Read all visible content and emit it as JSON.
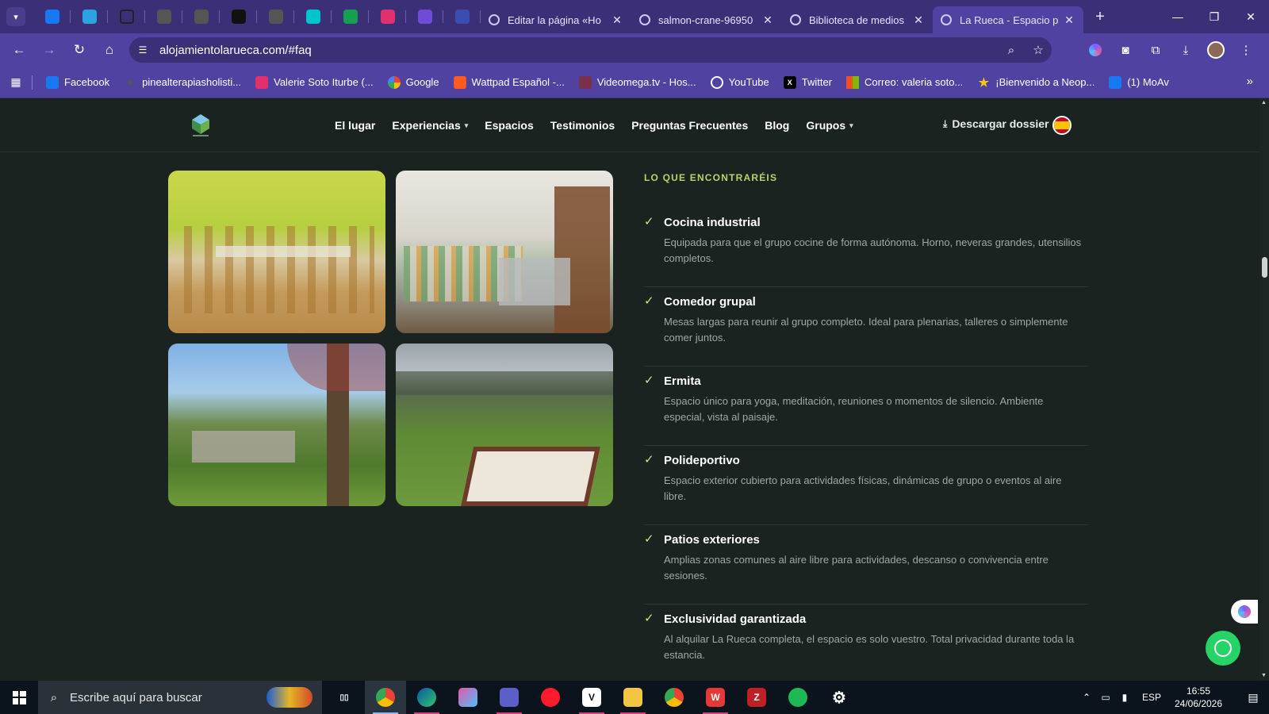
{
  "browser": {
    "tabs": [
      {
        "label": "Editar la página «Ho",
        "active": false
      },
      {
        "label": "salmon-crane-96950",
        "active": false
      },
      {
        "label": "Biblioteca de medios",
        "active": false
      },
      {
        "label": "La Rueca - Espacio p",
        "active": true
      }
    ],
    "pinned_icons": [
      "facebook-icon",
      "telegram-icon",
      "chatgpt-icon",
      "goodreads-icon",
      "goodreads-icon",
      "font-icon",
      "globe-icon",
      "canva-icon",
      "grammar-icon",
      "instagram-icon",
      "craft-icon",
      "dashboard-icon"
    ],
    "url": "alojamientolarueca.com/#faq",
    "bookmarks": [
      {
        "label": "Facebook",
        "icon": "facebook-icon",
        "color": "#1877f2"
      },
      {
        "label": "pinealterapiasholisti...",
        "icon": "dot-icon",
        "color": "#555555"
      },
      {
        "label": "Valerie Soto Iturbe (...",
        "icon": "instagram-icon",
        "color": "#e1306c"
      },
      {
        "label": "Google",
        "icon": "google-icon",
        "color": "#ffffff"
      },
      {
        "label": "Wattpad Español -...",
        "icon": "wattpad-icon",
        "color": "#ff5a1f"
      },
      {
        "label": "Videomega.tv - Hos...",
        "icon": "vm-icon",
        "color": "#7a2f4a"
      },
      {
        "label": "YouTube",
        "icon": "globe-icon",
        "color": "#555555"
      },
      {
        "label": "Twitter",
        "icon": "x-icon",
        "color": "#000000"
      },
      {
        "label": "Correo: valeria soto...",
        "icon": "microsoft-icon",
        "color": "#f25022"
      },
      {
        "label": "¡Bienvenido a Neop...",
        "icon": "star-icon",
        "color": "#f5c518"
      },
      {
        "label": "(1) MoAv",
        "icon": "facebook-icon",
        "color": "#1877f2"
      }
    ]
  },
  "site": {
    "nav": [
      {
        "label": "El lugar",
        "dropdown": false
      },
      {
        "label": "Experiencias",
        "dropdown": true
      },
      {
        "label": "Espacios",
        "dropdown": false
      },
      {
        "label": "Testimonios",
        "dropdown": false
      },
      {
        "label": "Preguntas Frecuentes",
        "dropdown": false
      },
      {
        "label": "Blog",
        "dropdown": false
      },
      {
        "label": "Grupos",
        "dropdown": true
      }
    ],
    "dossier_label": "Descargar dossier",
    "section_label": "LO QUE ENCONTRARÉIS",
    "features": [
      {
        "title": "Cocina industrial",
        "desc": "Equipada para que el grupo cocine de forma autónoma. Horno, neveras grandes, utensilios completos."
      },
      {
        "title": "Comedor grupal",
        "desc": "Mesas largas para reunir al grupo completo. Ideal para plenarias, talleres o simplemente comer juntos."
      },
      {
        "title": "Ermita",
        "desc": "Espacio único para yoga, meditación, reuniones o momentos de silencio. Ambiente especial, vista al paisaje."
      },
      {
        "title": "Polideportivo",
        "desc": "Espacio exterior cubierto para actividades físicas, dinámicas de grupo o eventos al aire libre."
      },
      {
        "title": "Patios exteriores",
        "desc": "Amplias zonas comunes al aire libre para actividades, descanso o convivencia entre sesiones."
      },
      {
        "title": "Exclusividad garantizada",
        "desc": "Al alquilar La Rueca completa, el espacio es solo vuestro. Total privacidad durante toda la estancia."
      }
    ],
    "accent_color": "#b8d36b"
  },
  "taskbar": {
    "search_placeholder": "Escribe aquí para buscar",
    "apps": [
      "task-view-icon",
      "chrome-icon",
      "edge-icon",
      "paint-icon",
      "teams-icon",
      "opera-icon",
      "v-icon",
      "file-explorer-icon",
      "chrome-profile-icon",
      "wps-icon",
      "filezilla-icon",
      "spotify-icon",
      "settings-icon"
    ],
    "lang": "ESP",
    "time": "16:55",
    "date": "24/06/2026"
  }
}
